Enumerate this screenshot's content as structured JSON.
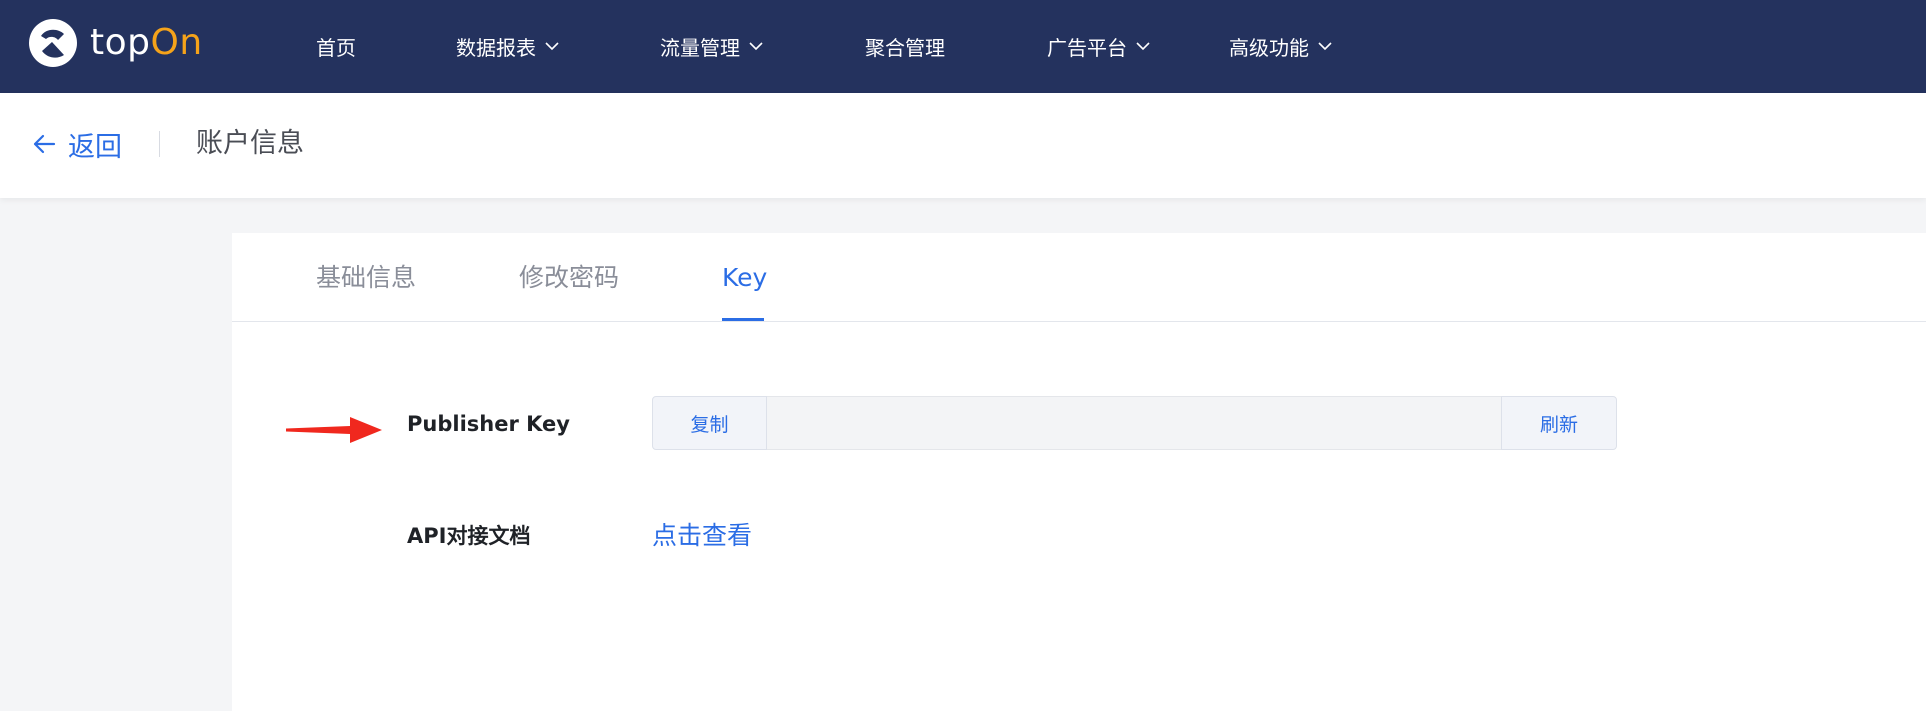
{
  "brand": {
    "name_part1": "top",
    "name_part2": "On",
    "accent_color": "#f5a31a",
    "nav_bg_color": "#24325e"
  },
  "nav": {
    "items": [
      {
        "label": "首页",
        "has_dropdown": false
      },
      {
        "label": "数据报表",
        "has_dropdown": true
      },
      {
        "label": "流量管理",
        "has_dropdown": true
      },
      {
        "label": "聚合管理",
        "has_dropdown": false
      },
      {
        "label": "广告平台",
        "has_dropdown": true
      },
      {
        "label": "高级功能",
        "has_dropdown": true
      }
    ]
  },
  "header": {
    "back_label": "返回",
    "title": "账户信息"
  },
  "tabs": [
    {
      "label": "基础信息",
      "active": false
    },
    {
      "label": "修改密码",
      "active": false
    },
    {
      "label": "Key",
      "active": true
    }
  ],
  "publisher_key": {
    "label": "Publisher Key",
    "copy_label": "复制",
    "value": "",
    "refresh_label": "刷新"
  },
  "api_doc": {
    "label": "API对接文档",
    "link_label": "点击查看"
  },
  "colors": {
    "link_blue": "#2b6de5",
    "annotation_arrow_red": "#f0281e"
  }
}
